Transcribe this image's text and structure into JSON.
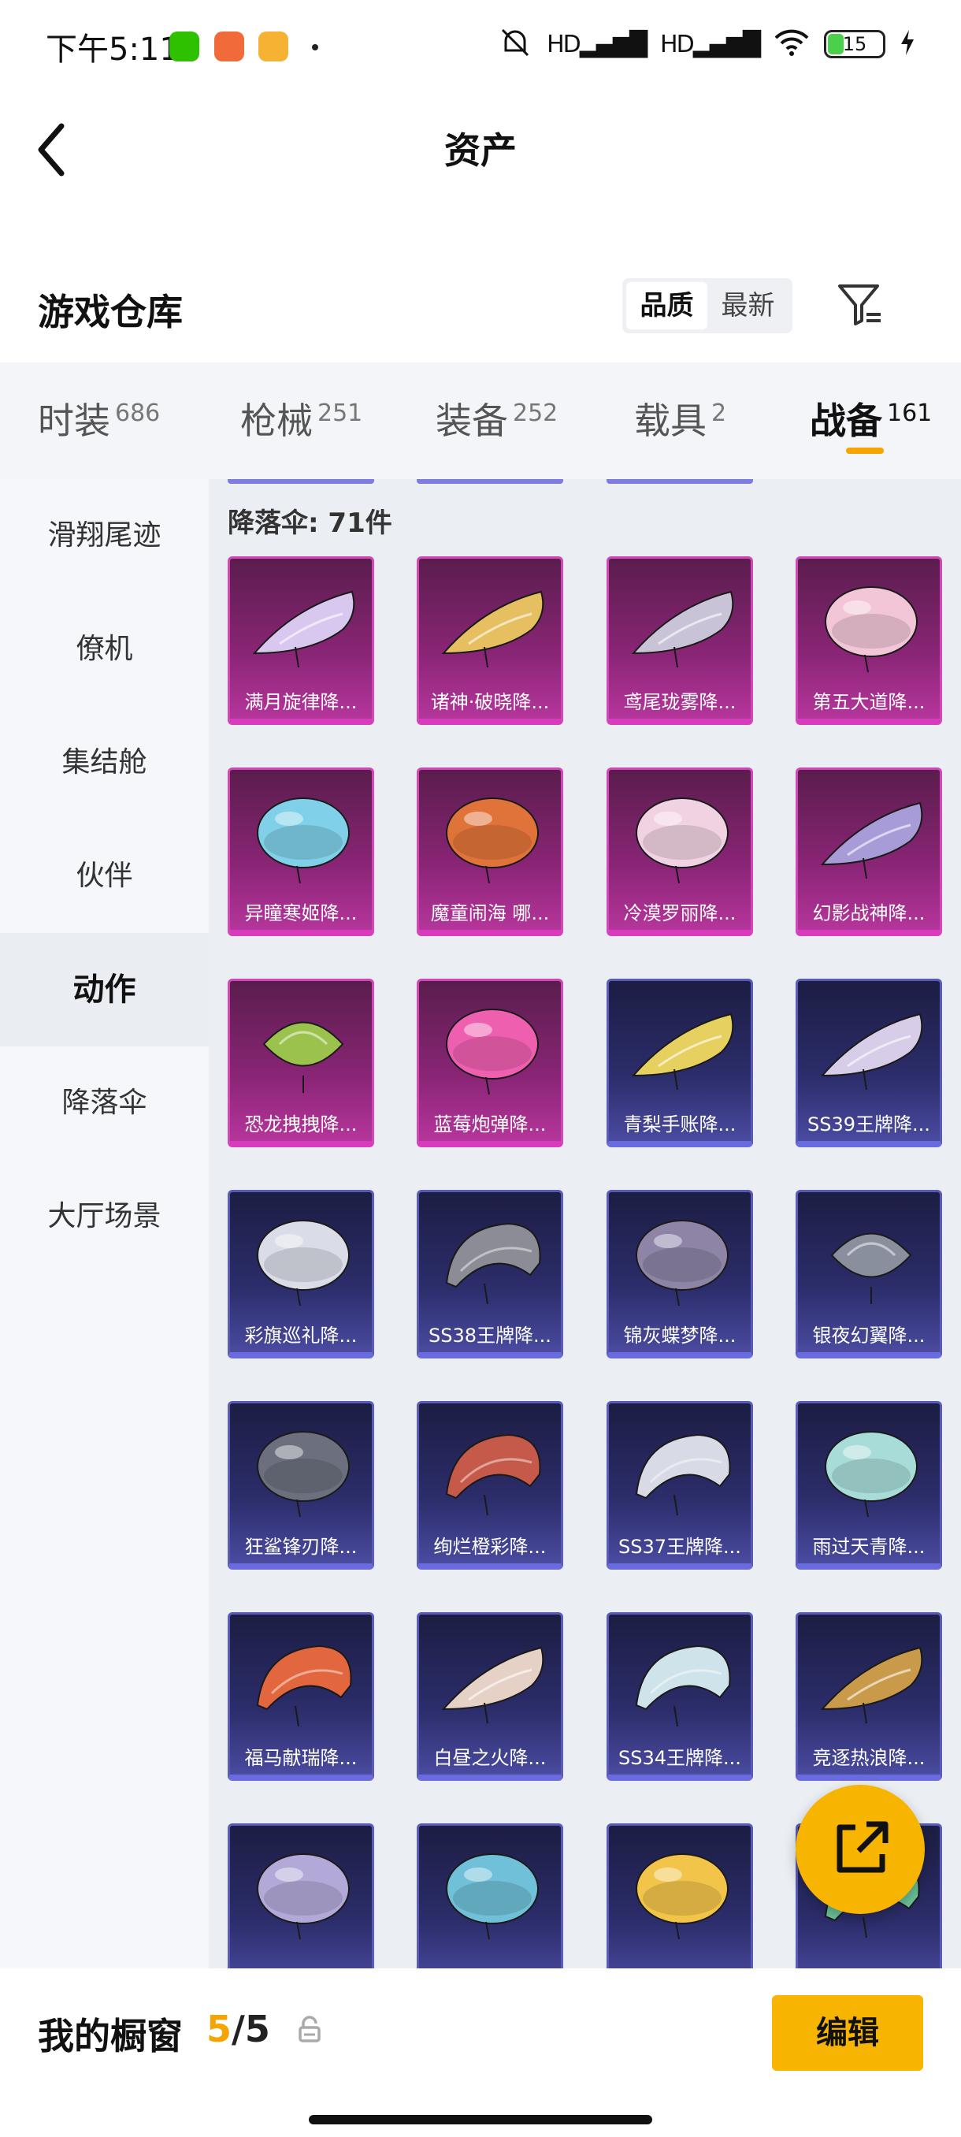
{
  "status_bar": {
    "time": "下午5:11",
    "signal_1": "HD",
    "signal_2": "HD",
    "battery": "15"
  },
  "header": {
    "title": "资产"
  },
  "warehouse": {
    "title": "游戏仓库",
    "sort_options": [
      "品质",
      "最新"
    ],
    "sort_selected": "品质"
  },
  "category_tabs": [
    {
      "label": "时装",
      "count": "686"
    },
    {
      "label": "枪械",
      "count": "251"
    },
    {
      "label": "装备",
      "count": "252"
    },
    {
      "label": "载具",
      "count": "2"
    },
    {
      "label": "战备",
      "count": "161",
      "active": true
    }
  ],
  "sidebar": {
    "items": [
      "滑翔尾迹",
      "僚机",
      "集结舱",
      "伙伴",
      "动作",
      "降落伞",
      "大厅场景"
    ],
    "active": "动作"
  },
  "section": {
    "title": "降落伞: 71件"
  },
  "items": [
    {
      "label": "满月旋律降...",
      "rarity": "epic",
      "icon": "wing-glider",
      "color": "#d8c8f0"
    },
    {
      "label": "诸神·破晓降...",
      "rarity": "epic",
      "icon": "wing-glider",
      "color": "#e6c060"
    },
    {
      "label": "鸢尾珑雾降...",
      "rarity": "epic",
      "icon": "wing-glider",
      "color": "#c9c3d8"
    },
    {
      "label": "第五大道降...",
      "rarity": "epic",
      "icon": "round-chute",
      "color": "#f2c6d6"
    },
    {
      "label": "异瞳寒姬降...",
      "rarity": "epic",
      "icon": "round-chute",
      "color": "#7fd0e8"
    },
    {
      "label": "魔童闹海 哪...",
      "rarity": "epic",
      "icon": "round-chute",
      "color": "#e0733a"
    },
    {
      "label": "冷漠罗丽降...",
      "rarity": "epic",
      "icon": "round-chute",
      "color": "#f1d2e2"
    },
    {
      "label": "幻影战神降...",
      "rarity": "epic",
      "icon": "wing-glider",
      "color": "#a79cd8"
    },
    {
      "label": "恐龙拽拽降...",
      "rarity": "epic",
      "icon": "square-chute",
      "color": "#9cc24e"
    },
    {
      "label": "蓝莓炮弹降...",
      "rarity": "epic",
      "icon": "round-chute",
      "color": "#ee5fb0"
    },
    {
      "label": "青梨手账降...",
      "rarity": "rare",
      "icon": "wing-glider",
      "color": "#e6d060"
    },
    {
      "label": "SS39王牌降...",
      "rarity": "rare",
      "icon": "wing-glider",
      "color": "#d7cde8"
    },
    {
      "label": "彩旗巡礼降...",
      "rarity": "rare",
      "icon": "round-chute",
      "color": "#dadde8"
    },
    {
      "label": "SS38王牌降...",
      "rarity": "rare",
      "icon": "arc-chute",
      "color": "#8c8c96"
    },
    {
      "label": "锦灰蝶梦降...",
      "rarity": "rare",
      "icon": "round-chute",
      "color": "#8d84a6"
    },
    {
      "label": "银夜幻翼降...",
      "rarity": "rare",
      "icon": "square-chute",
      "color": "#8a8f9e"
    },
    {
      "label": "狂鲨锋刃降...",
      "rarity": "rare",
      "icon": "round-chute",
      "color": "#6b6f7e"
    },
    {
      "label": "绚烂橙彩降...",
      "rarity": "rare",
      "icon": "arc-chute",
      "color": "#c65a4a"
    },
    {
      "label": "SS37王牌降...",
      "rarity": "rare",
      "icon": "arc-chute",
      "color": "#d8dbe6"
    },
    {
      "label": "雨过天青降...",
      "rarity": "rare",
      "icon": "round-chute",
      "color": "#a8dcd8"
    },
    {
      "label": "福马献瑞降...",
      "rarity": "rare",
      "icon": "arc-chute",
      "color": "#e2663e"
    },
    {
      "label": "白昼之火降...",
      "rarity": "rare",
      "icon": "wing-glider",
      "color": "#e6d1c6"
    },
    {
      "label": "SS34王牌降...",
      "rarity": "rare",
      "icon": "arc-chute",
      "color": "#cfe3ea"
    },
    {
      "label": "竞逐热浪降...",
      "rarity": "rare",
      "icon": "wing-glider",
      "color": "#c89a4a"
    },
    {
      "label": "",
      "rarity": "rare",
      "icon": "round-chute",
      "color": "#b3a9d8"
    },
    {
      "label": "",
      "rarity": "rare",
      "icon": "round-chute",
      "color": "#6fc0d8"
    },
    {
      "label": "",
      "rarity": "rare",
      "icon": "round-chute",
      "color": "#f2c44a"
    },
    {
      "label": "",
      "rarity": "rare",
      "icon": "arc-chute",
      "color": "#6ac29a"
    }
  ],
  "bottom_bar": {
    "showcase_label": "我的橱窗",
    "showcase_current": "5",
    "showcase_total": "/5",
    "edit_label": "编辑"
  }
}
